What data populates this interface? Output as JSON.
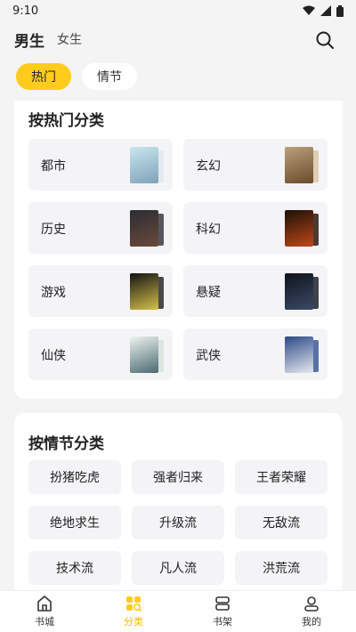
{
  "status": {
    "time": "9:10"
  },
  "header": {
    "male_label": "男生",
    "female_label": "女生"
  },
  "tabs": [
    {
      "label": "热门"
    },
    {
      "label": "情节"
    }
  ],
  "hot": {
    "title": "按热门分类",
    "items": [
      {
        "label": "都市",
        "cover_colors": [
          "#c8e6ef",
          "#7fa2b8"
        ]
      },
      {
        "label": "玄幻",
        "cover_colors": [
          "#b9a07a",
          "#6b4a2d"
        ]
      },
      {
        "label": "历史",
        "cover_colors": [
          "#2c2c34",
          "#6a4a3a"
        ]
      },
      {
        "label": "科幻",
        "cover_colors": [
          "#1a1008",
          "#c24818"
        ]
      },
      {
        "label": "游戏",
        "cover_colors": [
          "#141414",
          "#d6c04a"
        ]
      },
      {
        "label": "悬疑",
        "cover_colors": [
          "#10141c",
          "#3a4a66"
        ]
      },
      {
        "label": "仙侠",
        "cover_colors": [
          "#eef3ee",
          "#4a6a72"
        ]
      },
      {
        "label": "武侠",
        "cover_colors": [
          "#2c4a86",
          "#e6e8ef"
        ]
      }
    ]
  },
  "plot": {
    "title": "按情节分类",
    "items": [
      {
        "label": "扮猪吃虎"
      },
      {
        "label": "强者归来"
      },
      {
        "label": "王者荣耀"
      },
      {
        "label": "绝地求生"
      },
      {
        "label": "升级流"
      },
      {
        "label": "无敌流"
      },
      {
        "label": "技术流"
      },
      {
        "label": "凡人流"
      },
      {
        "label": "洪荒流"
      }
    ]
  },
  "nav": [
    {
      "label": "书城",
      "icon": "home-icon"
    },
    {
      "label": "分类",
      "icon": "category-icon"
    },
    {
      "label": "书架",
      "icon": "bookshelf-icon"
    },
    {
      "label": "我的",
      "icon": "profile-icon"
    }
  ],
  "colors": {
    "accent": "#ffcc1e",
    "accent_text": "#f5b800"
  }
}
